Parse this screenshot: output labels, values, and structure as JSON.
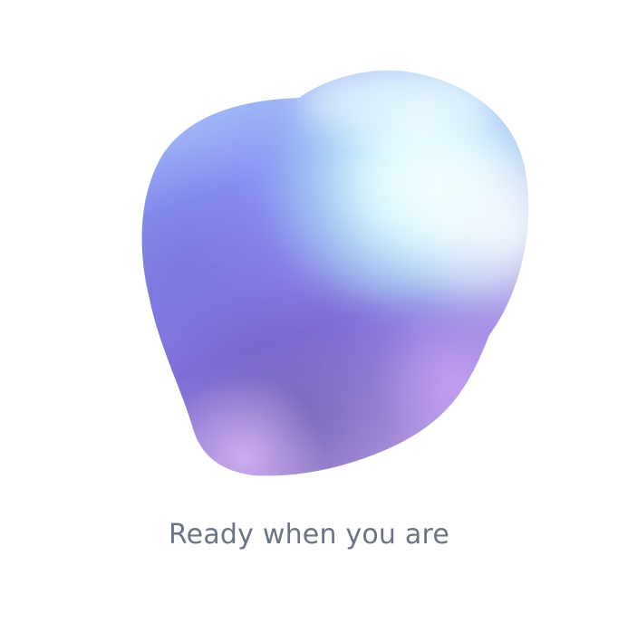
{
  "status": {
    "text": "Ready when you are"
  },
  "orb": {
    "icon": "voice-orb",
    "colors": {
      "cyan": "#cffcff",
      "periwinkle": "#8b8cf2",
      "violet": "#9a86f0",
      "deep_violet": "#6e5fb8",
      "lavender": "#c9a9ee",
      "text": "#6b7486"
    }
  }
}
